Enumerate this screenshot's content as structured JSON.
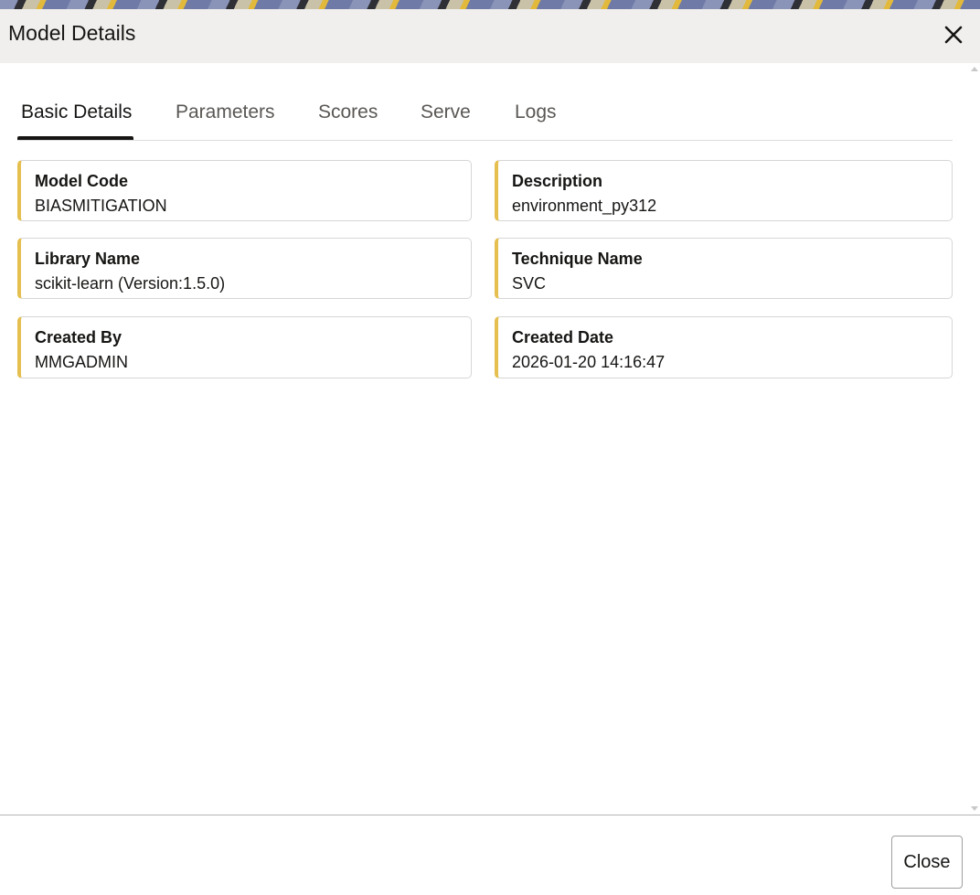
{
  "dialog": {
    "title": "Model Details",
    "close_icon": "close-icon"
  },
  "tabs": [
    {
      "label": "Basic Details",
      "active": true
    },
    {
      "label": "Parameters",
      "active": false
    },
    {
      "label": "Scores",
      "active": false
    },
    {
      "label": "Serve",
      "active": false
    },
    {
      "label": "Logs",
      "active": false
    }
  ],
  "details": [
    {
      "label": "Model Code",
      "value": "BIASMITIGATION"
    },
    {
      "label": "Description",
      "value": "environment_py312"
    },
    {
      "label": "Library Name",
      "value": "scikit-learn (Version:1.5.0)"
    },
    {
      "label": "Technique Name",
      "value": "SVC"
    },
    {
      "label": "Created By",
      "value": "MMGADMIN"
    },
    {
      "label": "Created Date",
      "value": "2026-01-20 14:16:47"
    }
  ],
  "footer": {
    "close_label": "Close"
  },
  "colors": {
    "card_accent": "#e5bf4f",
    "header_background": "#f0efed",
    "active_tab_indicator": "#161513"
  }
}
